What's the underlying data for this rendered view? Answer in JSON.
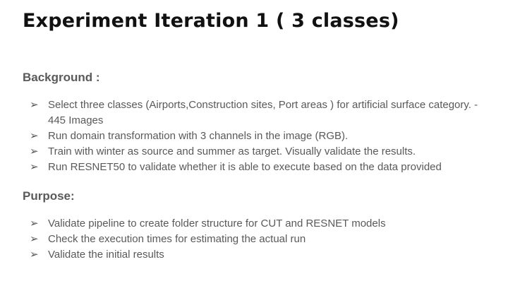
{
  "slide": {
    "title": "Experiment Iteration 1 ( 3 classes)",
    "bullet_marker": "➢",
    "background": {
      "heading": "Background :",
      "items": [
        "Select three classes (Airports,Construction sites, Port areas ) for artificial surface category. - 445 Images",
        "Run domain transformation with 3 channels in the image (RGB).",
        "Train with winter as source and summer as target. Visually validate the results.",
        "Run RESNET50 to validate whether it is able to execute based on the data provided"
      ]
    },
    "purpose": {
      "heading": "Purpose:",
      "items": [
        "Validate pipeline to create folder structure for CUT and RESNET models",
        "Check the execution times for estimating the actual run",
        "Validate the initial results"
      ]
    }
  }
}
